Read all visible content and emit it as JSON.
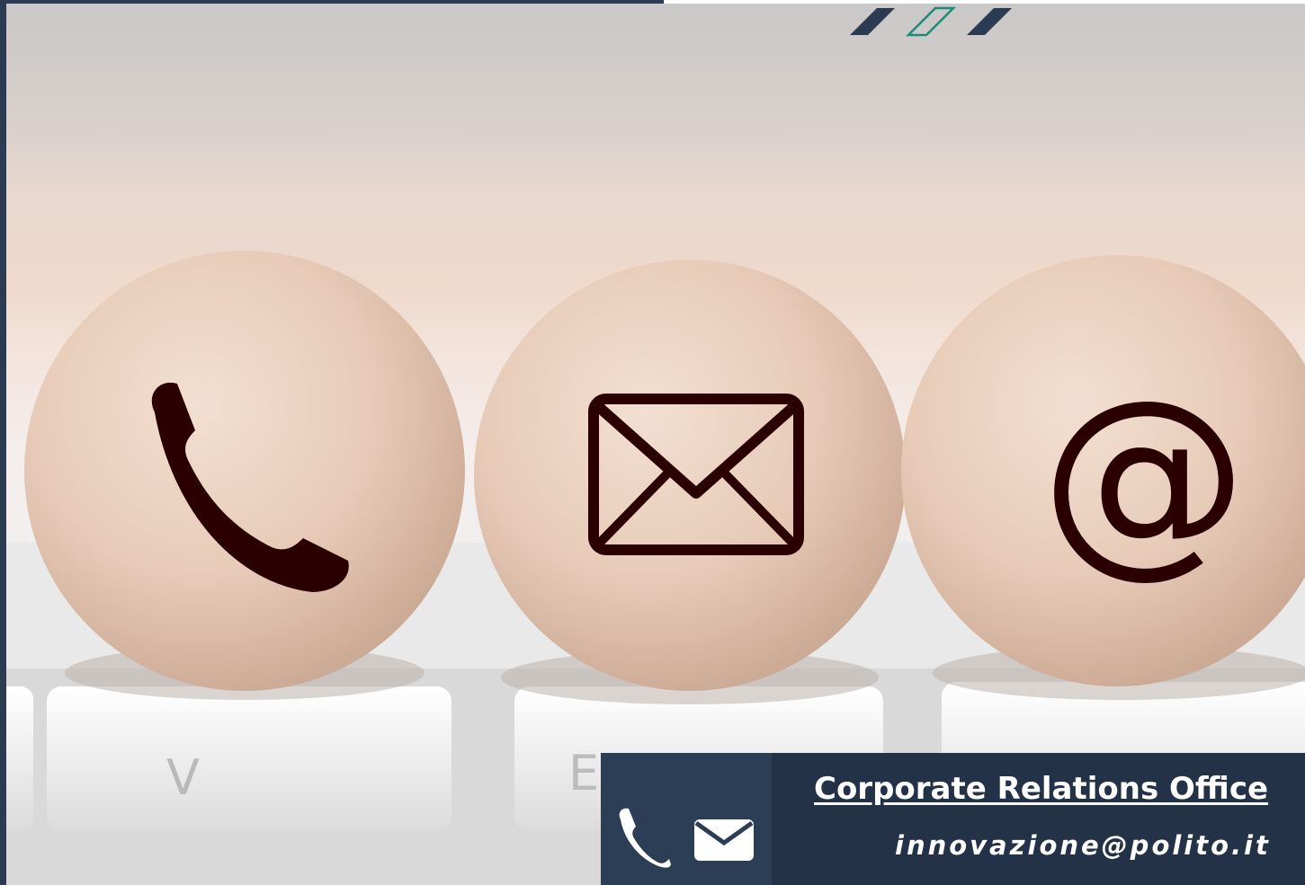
{
  "card": {
    "title": "Corporate Relations Office",
    "email": "innovazione@polito.it",
    "phone_partial": "",
    "icons": [
      "phone-icon",
      "envelope-icon"
    ]
  },
  "photo": {
    "balls": [
      "phone-icon",
      "envelope-icon",
      "at-sign-icon"
    ],
    "keys": [
      "V",
      "E"
    ]
  },
  "colors": {
    "navy": "#233246",
    "navy_light": "#2c3e55",
    "teal_accent": "#1e8a78",
    "icon_dark": "#2a0000"
  }
}
